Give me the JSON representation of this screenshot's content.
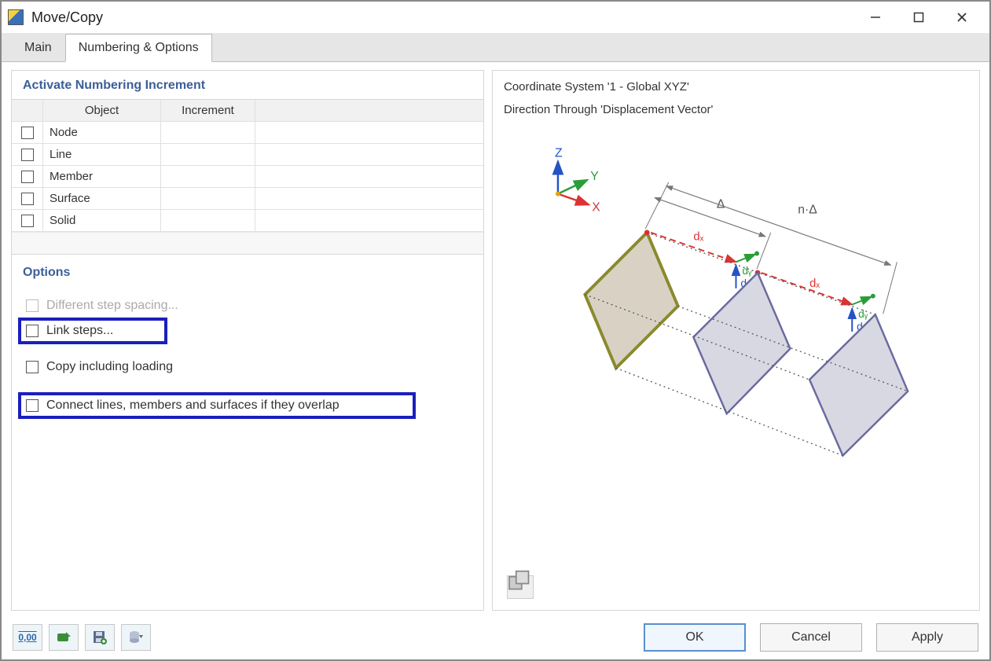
{
  "window": {
    "title": "Move/Copy"
  },
  "tabs": {
    "main": "Main",
    "numbering": "Numbering & Options",
    "active": "numbering"
  },
  "numbering_panel": {
    "title": "Activate Numbering Increment",
    "columns": {
      "object": "Object",
      "increment": "Increment"
    },
    "rows": [
      {
        "label": "Node",
        "checked": false,
        "increment": ""
      },
      {
        "label": "Line",
        "checked": false,
        "increment": ""
      },
      {
        "label": "Member",
        "checked": false,
        "increment": ""
      },
      {
        "label": "Surface",
        "checked": false,
        "increment": ""
      },
      {
        "label": "Solid",
        "checked": false,
        "increment": ""
      }
    ]
  },
  "options_panel": {
    "title": "Options",
    "different_step": "Different step spacing...",
    "link_steps": "Link steps...",
    "copy_loading": "Copy including loading",
    "connect_overlap": "Connect lines, members and surfaces if they overlap"
  },
  "preview": {
    "line1": "Coordinate System '1 - Global XYZ'",
    "line2": "Direction Through 'Displacement Vector'",
    "axes": {
      "x": "X",
      "y": "Y",
      "z": "Z"
    },
    "labels": {
      "delta": "Δ",
      "ndelta": "n·Δ",
      "dx": "dₓ",
      "dy": "dᵧ",
      "dz": "d𝓏"
    }
  },
  "buttons": {
    "ok": "OK",
    "cancel": "Cancel",
    "apply": "Apply"
  },
  "toolbar_icons": {
    "units": "0,00",
    "import": "import-icon",
    "save": "save-icon",
    "db": "db-icon"
  }
}
